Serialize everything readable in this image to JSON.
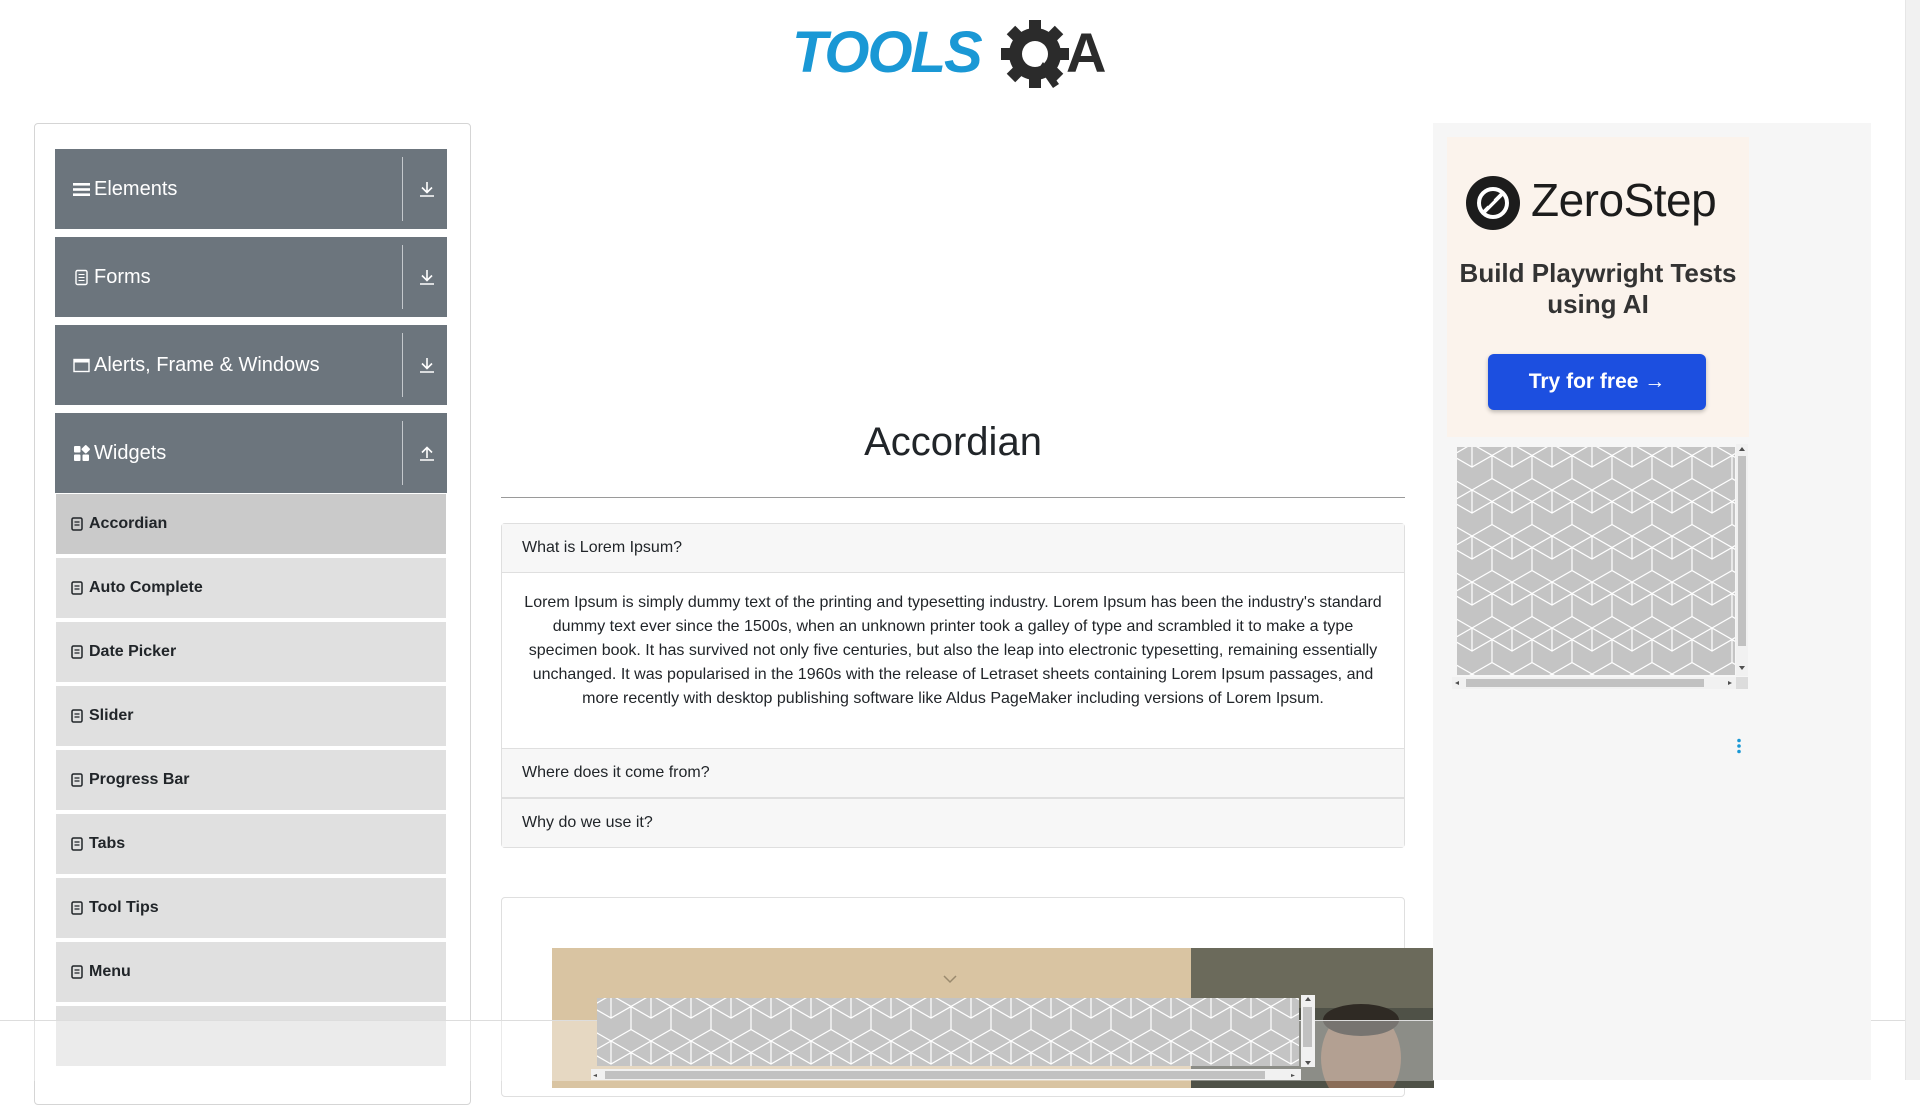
{
  "header": {
    "logo_text": "TOOLSQA"
  },
  "sidebar": {
    "groups": [
      {
        "label": "Elements",
        "icon": "hamburger-icon",
        "toggle_icon": "download-arrow-icon"
      },
      {
        "label": "Forms",
        "icon": "document-icon",
        "toggle_icon": "download-arrow-icon"
      },
      {
        "label": "Alerts, Frame & Windows",
        "icon": "window-icon",
        "toggle_icon": "download-arrow-icon"
      },
      {
        "label": "Widgets",
        "icon": "widgets-grid-icon",
        "toggle_icon": "upload-arrow-icon"
      }
    ],
    "items": [
      {
        "label": "Accordian",
        "active": true
      },
      {
        "label": "Auto Complete"
      },
      {
        "label": "Date Picker"
      },
      {
        "label": "Slider"
      },
      {
        "label": "Progress Bar"
      },
      {
        "label": "Tabs"
      },
      {
        "label": "Tool Tips"
      },
      {
        "label": "Menu"
      }
    ],
    "header_color": "#6c757d",
    "item_color": "#e0e0e0"
  },
  "main": {
    "title": "Accordian",
    "accordion": [
      {
        "title": "What is Lorem Ipsum?",
        "body": "Lorem Ipsum is simply dummy text of the printing and typesetting industry. Lorem Ipsum has been the industry's standard dummy text ever since the 1500s, when an unknown printer took a galley of type and scrambled it to make a type specimen book. It has survived not only five centuries, but also the leap into electronic typesetting, remaining essentially unchanged. It was popularised in the 1960s with the release of Letraset sheets containing Lorem Ipsum passages, and more recently with desktop publishing software like Aldus PageMaker including versions of Lorem Ipsum."
      },
      {
        "title": "Where does it come from?"
      },
      {
        "title": "Why do we use it?"
      }
    ]
  },
  "ad": {
    "brand": "ZeroStep",
    "tagline": "Build Playwright Tests using AI",
    "cta": "Try for free →",
    "cta_color": "#1c4fe0"
  }
}
